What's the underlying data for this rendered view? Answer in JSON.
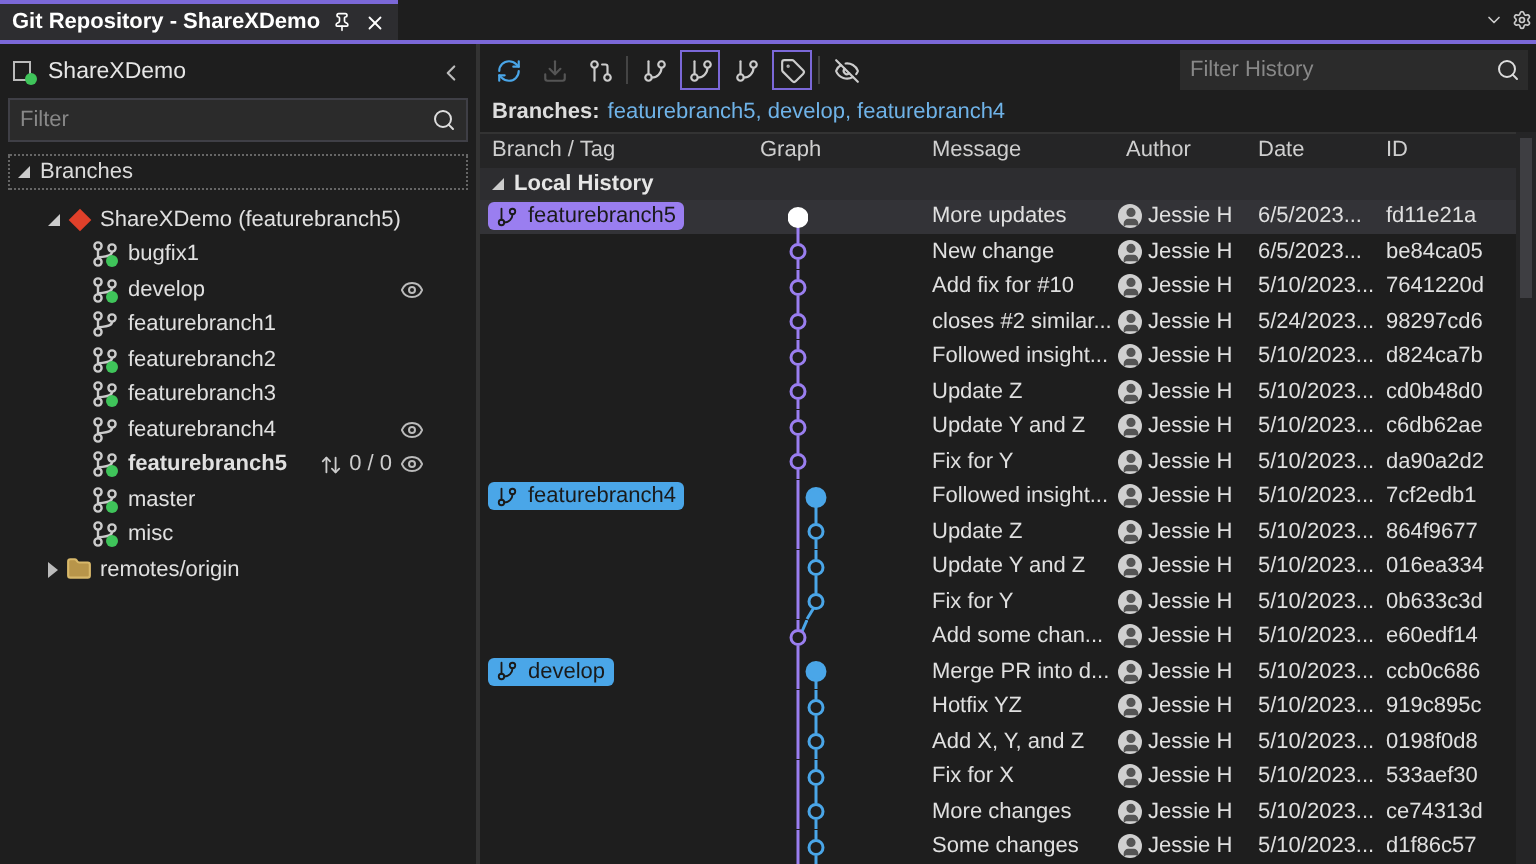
{
  "tab": {
    "title": "Git Repository - ShareXDemo"
  },
  "sidebar": {
    "repo": "ShareXDemo",
    "filter_placeholder": "Filter",
    "section": "Branches",
    "section_expanded": true,
    "tree": [
      {
        "label": "ShareXDemo (featurebranch5)",
        "kind": "repo",
        "expanded": true,
        "children": [
          {
            "label": "bugfix1",
            "kind": "branch",
            "published": true,
            "current": false,
            "tracked": false
          },
          {
            "label": "develop",
            "kind": "branch",
            "published": true,
            "current": false,
            "tracked": true
          },
          {
            "label": "featurebranch1",
            "kind": "branch",
            "published": false,
            "current": false,
            "tracked": false
          },
          {
            "label": "featurebranch2",
            "kind": "branch",
            "published": true,
            "current": false,
            "tracked": false
          },
          {
            "label": "featurebranch3",
            "kind": "branch",
            "published": true,
            "current": false,
            "tracked": false
          },
          {
            "label": "featurebranch4",
            "kind": "branch",
            "published": false,
            "current": false,
            "tracked": true
          },
          {
            "label": "featurebranch5",
            "kind": "branch",
            "published": true,
            "current": true,
            "tracked": true,
            "sync": "0 / 0"
          },
          {
            "label": "master",
            "kind": "branch",
            "published": true,
            "current": false,
            "tracked": false
          },
          {
            "label": "misc",
            "kind": "branch",
            "published": true,
            "current": false,
            "tracked": false
          }
        ]
      },
      {
        "label": "remotes/origin",
        "kind": "remote",
        "expanded": false
      }
    ]
  },
  "toolbar": [
    {
      "kind": "refresh",
      "selected": false,
      "disabled": false
    },
    {
      "kind": "fetch",
      "selected": false,
      "disabled": true
    },
    {
      "kind": "pull",
      "selected": false,
      "disabled": false
    },
    {
      "kind": "graph",
      "selected": false,
      "disabled": false
    },
    {
      "kind": "branches",
      "selected": true,
      "disabled": false
    },
    {
      "kind": "remote",
      "selected": false,
      "disabled": false
    },
    {
      "kind": "tags",
      "selected": true,
      "disabled": false
    },
    {
      "kind": "hide",
      "selected": false,
      "disabled": false
    }
  ],
  "filter_history": {
    "placeholder": "Filter History"
  },
  "branches_line": {
    "label": "Branches:",
    "value": "featurebranch5, develop, featurebranch4"
  },
  "columns": [
    "Branch / Tag",
    "Graph",
    "Message",
    "Author",
    "Date",
    "ID"
  ],
  "section": {
    "label": "Local History",
    "expanded": true
  },
  "rows": [
    {
      "tag": {
        "label": "featurebranch5",
        "color": "#9a7ef0"
      },
      "kind": "head",
      "message": "More updates",
      "author": "Jessie H",
      "date": "6/5/2023...",
      "id": "fd11e21a",
      "selected": true
    },
    {
      "kind": "main",
      "message": "New change",
      "author": "Jessie H",
      "date": "6/5/2023...",
      "id": "be84ca05",
      "selected": false
    },
    {
      "kind": "main",
      "message": "Add fix for #10",
      "author": "Jessie H",
      "date": "5/10/2023...",
      "id": "7641220d",
      "selected": false
    },
    {
      "kind": "main",
      "message": "closes #2 similar...",
      "author": "Jessie H",
      "date": "5/24/2023...",
      "id": "98297cd6",
      "selected": false
    },
    {
      "kind": "main",
      "message": "Followed insight...",
      "author": "Jessie H",
      "date": "5/10/2023...",
      "id": "d824ca7b",
      "selected": false
    },
    {
      "kind": "main",
      "message": "Update Z",
      "author": "Jessie H",
      "date": "5/10/2023...",
      "id": "cd0b48d0",
      "selected": false
    },
    {
      "kind": "main",
      "message": "Update Y and Z",
      "author": "Jessie H",
      "date": "5/10/2023...",
      "id": "c6db62ae",
      "selected": false
    },
    {
      "kind": "main",
      "message": "Fix for Y",
      "author": "Jessie H",
      "date": "5/10/2023...",
      "id": "da90a2d2",
      "selected": false
    },
    {
      "tag": {
        "label": "featurebranch4",
        "color": "#4aa6e8"
      },
      "kind": "sidetip",
      "message": "Followed insight...",
      "author": "Jessie H",
      "date": "5/10/2023...",
      "id": "7cf2edb1",
      "selected": false
    },
    {
      "kind": "side",
      "message": "Update Z",
      "author": "Jessie H",
      "date": "5/10/2023...",
      "id": "864f9677",
      "selected": false
    },
    {
      "kind": "side",
      "message": "Update Y and Z",
      "author": "Jessie H",
      "date": "5/10/2023...",
      "id": "016ea334",
      "selected": false
    },
    {
      "kind": "side",
      "message": "Fix for Y",
      "author": "Jessie H",
      "date": "5/10/2023...",
      "id": "0b633c3d",
      "selected": false
    },
    {
      "kind": "main",
      "message": "Add some chan...",
      "author": "Jessie H",
      "date": "5/10/2023...",
      "id": "e60edf14",
      "selected": false
    },
    {
      "tag": {
        "label": "develop",
        "color": "#4aa6e8"
      },
      "kind": "sidetip",
      "message": "Merge PR into d...",
      "author": "Jessie H",
      "date": "5/10/2023...",
      "id": "ccb0c686",
      "selected": false
    },
    {
      "kind": "side",
      "message": "Hotfix YZ",
      "author": "Jessie H",
      "date": "5/10/2023...",
      "id": "919c895c",
      "selected": false
    },
    {
      "kind": "side",
      "message": "Add X, Y, and Z",
      "author": "Jessie H",
      "date": "5/10/2023...",
      "id": "0198f0d8",
      "selected": false
    },
    {
      "kind": "side",
      "message": "Fix for X",
      "author": "Jessie H",
      "date": "5/10/2023...",
      "id": "533aef30",
      "selected": false
    },
    {
      "kind": "side",
      "message": "More changes",
      "author": "Jessie H",
      "date": "5/10/2023...",
      "id": "ce74313d",
      "selected": false
    },
    {
      "kind": "side",
      "message": "Some changes",
      "author": "Jessie H",
      "date": "5/10/2023...",
      "id": "d1f86c57",
      "selected": false
    }
  ]
}
